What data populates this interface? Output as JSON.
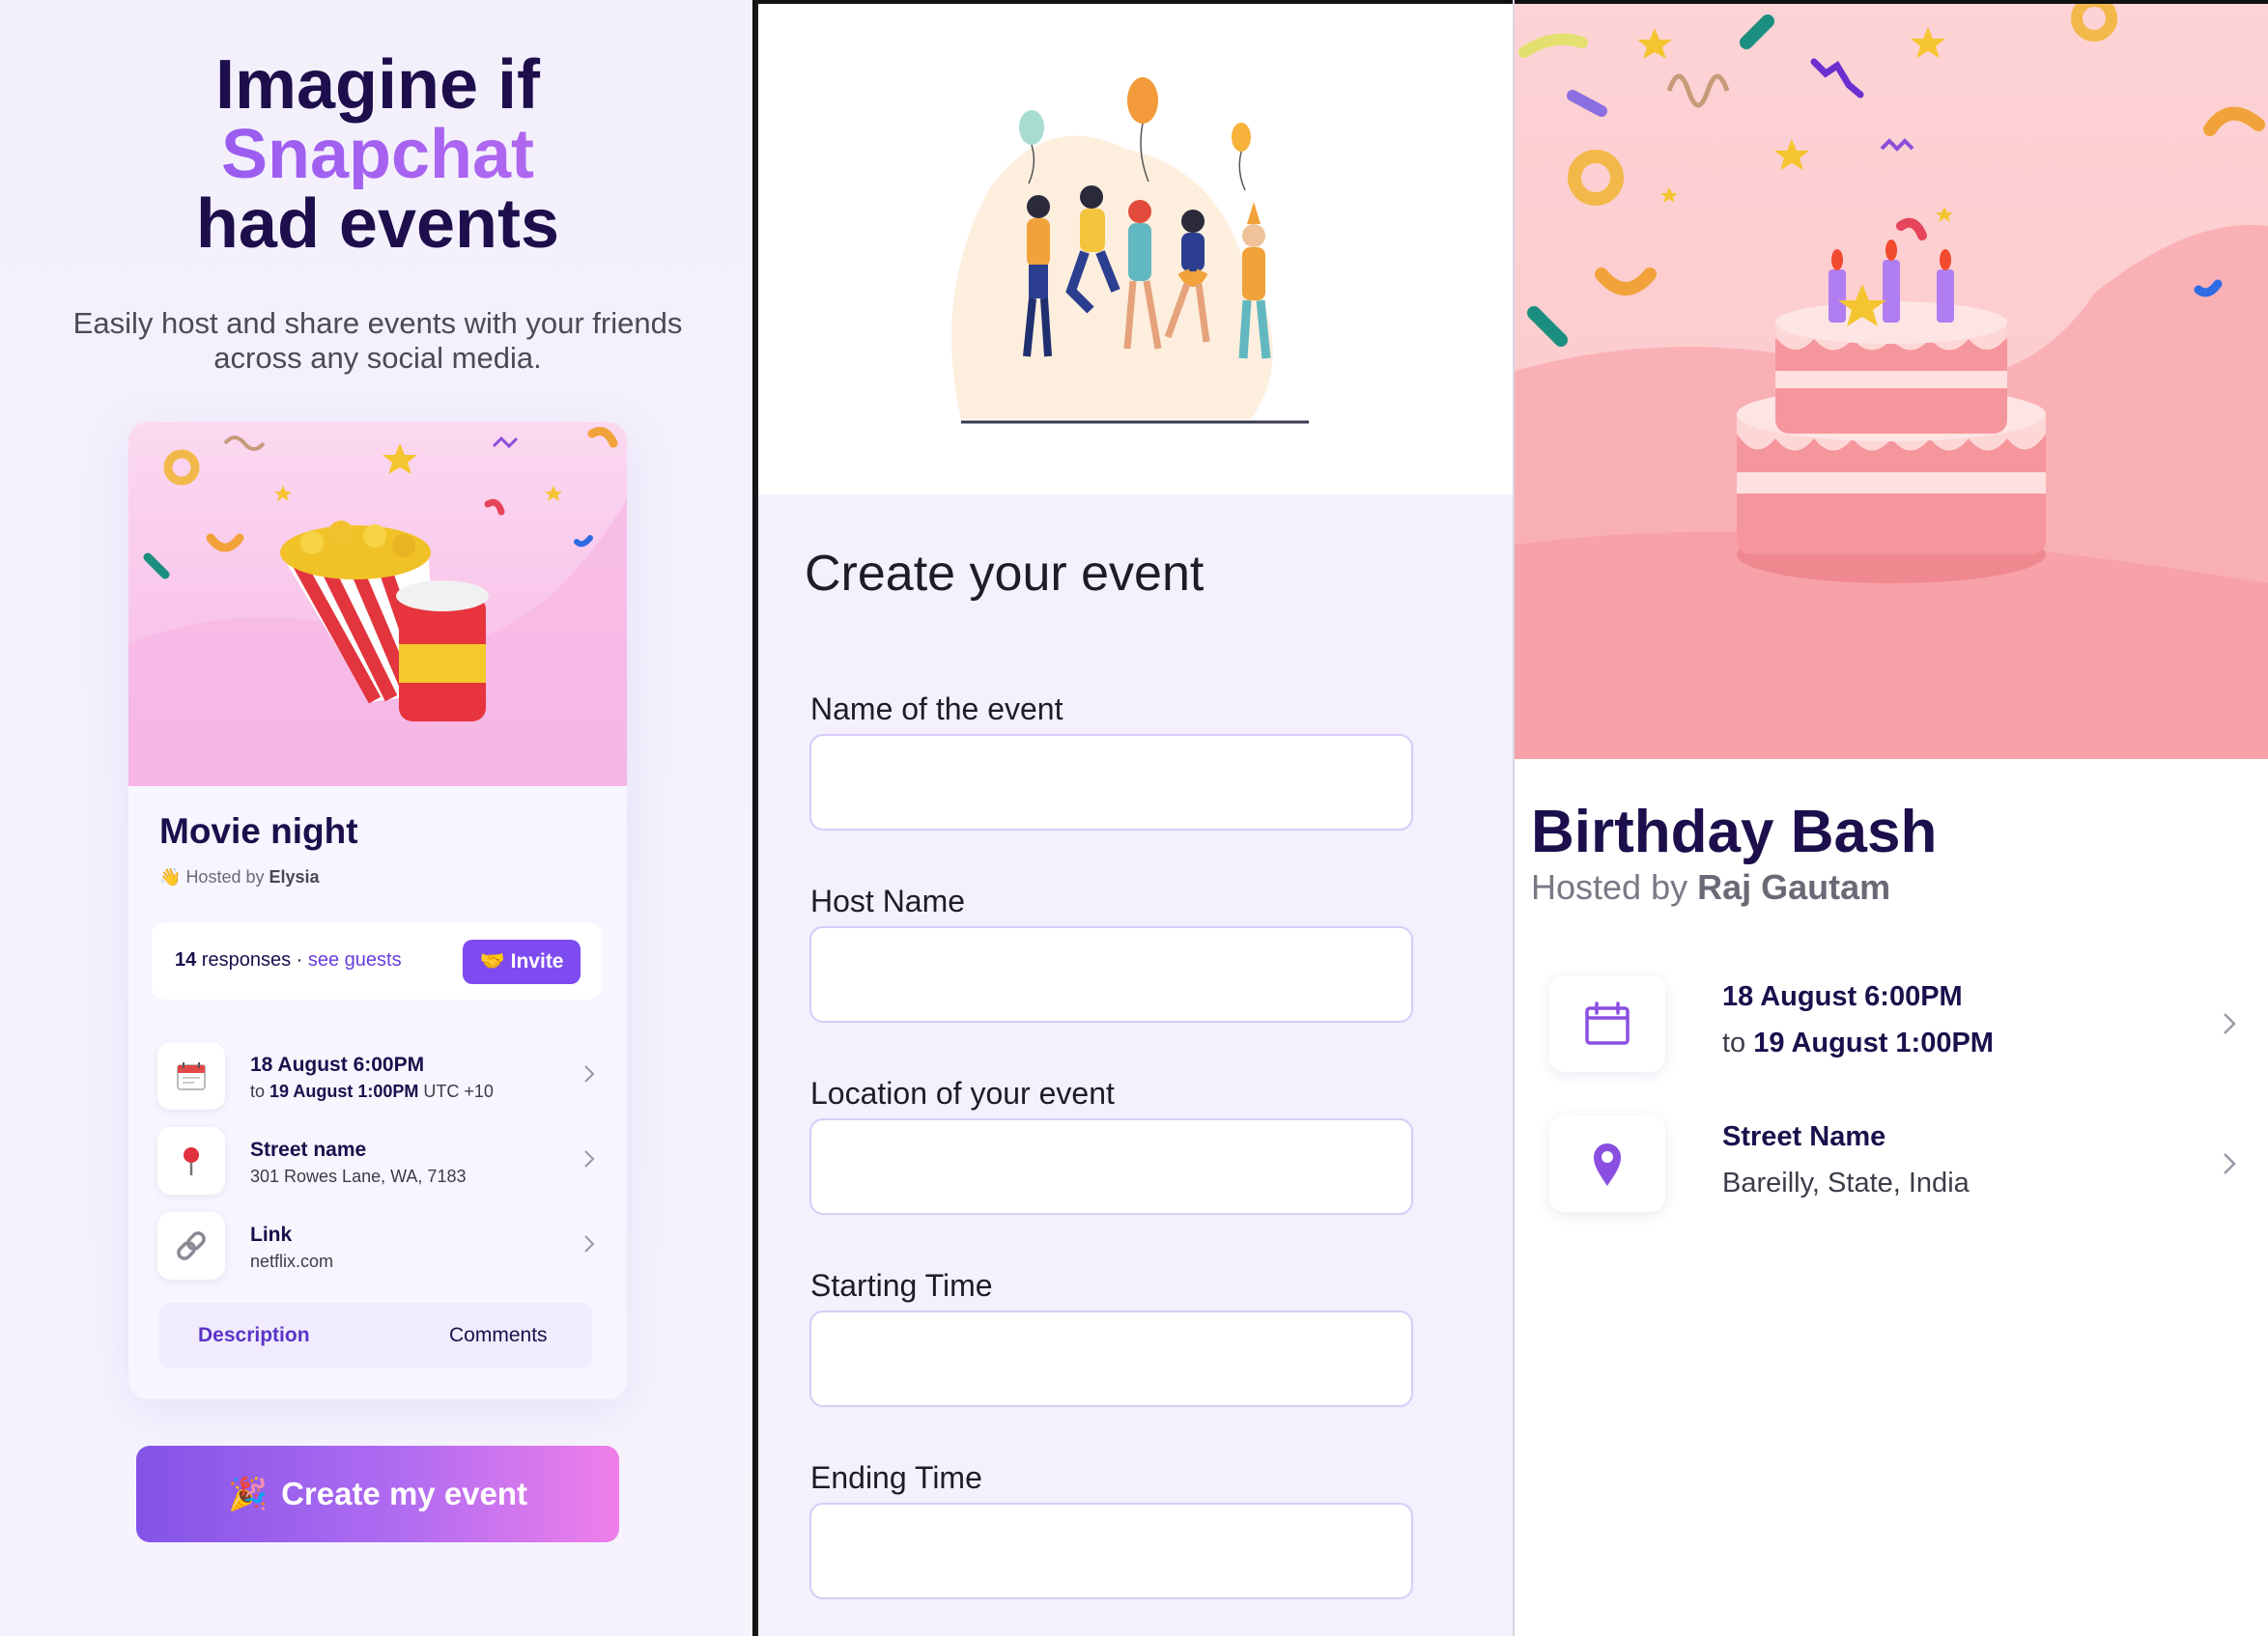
{
  "panel1": {
    "hero": {
      "line1": "Imagine if",
      "line2": "Snapchat",
      "line3": "had events"
    },
    "subtitle": {
      "line1": "Easily host and share events with your friends",
      "line2": "across any social media."
    },
    "card": {
      "title": "Movie night",
      "host_emoji": "👋",
      "host_prefix": "Hosted by ",
      "host_name": "Elysia",
      "responses_count": "14",
      "responses_label": " responses · ",
      "see_guests": "see guests",
      "invite_label": "Invite",
      "rows": [
        {
          "icon": "calendar-icon",
          "title": "18 August 6:00PM",
          "sub_prefix": "to ",
          "sub_bold": "19 August 1:00PM",
          "sub_suffix": " UTC +10"
        },
        {
          "icon": "pin-icon",
          "title": "Street name",
          "sub": "301 Rowes Lane, WA, 7183"
        },
        {
          "icon": "link-icon",
          "title": "Link",
          "sub": "netflix.com"
        }
      ],
      "tabs": {
        "description": "Description",
        "comments": "Comments"
      }
    },
    "create_button": "Create my event",
    "colors": {
      "navy": "#1c0f4c",
      "purple": "#7d4bef",
      "pink": "#ef7fea"
    }
  },
  "panel2": {
    "title": "Create your event",
    "fields": [
      {
        "label": "Name of the event",
        "value": ""
      },
      {
        "label": "Host Name",
        "value": ""
      },
      {
        "label": "Location of your event",
        "value": ""
      },
      {
        "label": "Starting Time",
        "value": ""
      },
      {
        "label": "Ending Time",
        "value": ""
      }
    ]
  },
  "panel3": {
    "title": "Birthday Bash",
    "host_prefix": "Hosted by ",
    "host_name": "Raj Gautam",
    "rows": [
      {
        "icon": "calendar-icon",
        "title": "18 August 6:00PM",
        "sub_prefix": "to ",
        "sub_bold": "19 August 1:00PM"
      },
      {
        "icon": "location-pin-icon",
        "title": "Street Name",
        "sub": "Bareilly, State, India"
      }
    ]
  }
}
